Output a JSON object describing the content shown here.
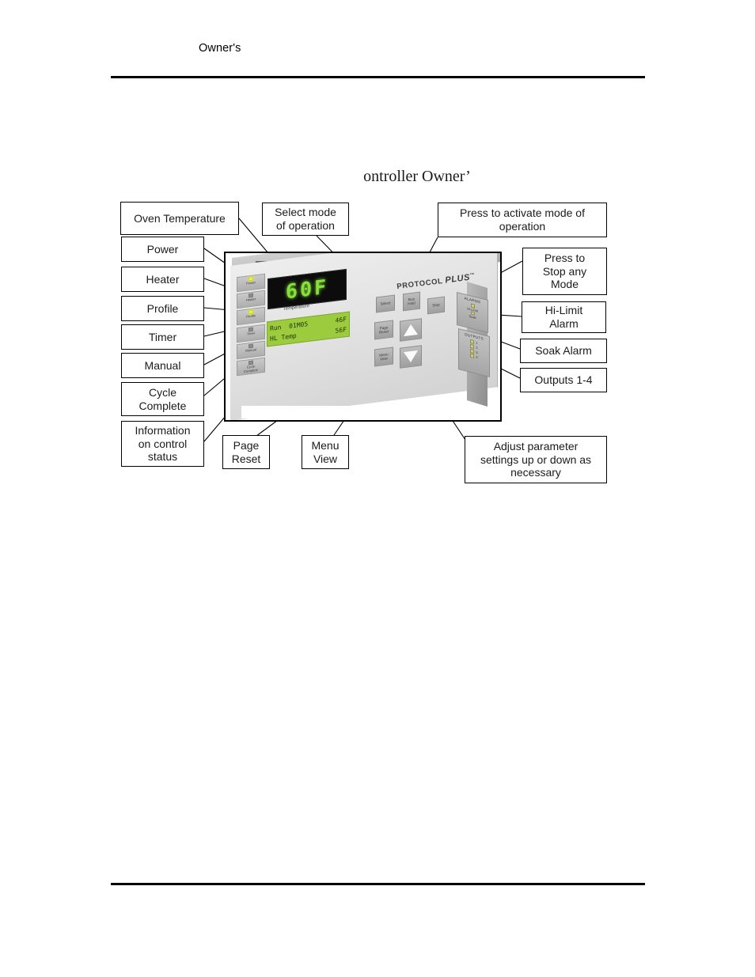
{
  "page": {
    "header_text": "Owner's",
    "title": "ontroller Owner’"
  },
  "callouts": {
    "oven_temperature": "Oven Temperature",
    "power": "Power",
    "heater": "Heater",
    "profile": "Profile",
    "timer": "Timer",
    "manual": "Manual",
    "cycle_complete": "Cycle\nComplete",
    "information_on_control_status": "Information\non control\nstatus",
    "select_mode": "Select mode\nof operation",
    "press_to_activate": "Press to activate mode of\noperation",
    "press_to_stop": "Press to\nStop any\nMode",
    "hi_limit_alarm": "Hi-Limit\nAlarm",
    "soak_alarm": "Soak Alarm",
    "outputs_1_4": "Outputs  1-4",
    "page_reset": "Page\nReset",
    "menu_view": "Menu\nView",
    "adjust_parameter": "Adjust parameter\nsettings up or down as\nnecessary"
  },
  "device": {
    "brand": "PROTOCOL",
    "brand_plus": "PLUS",
    "brand_tm": "™",
    "segment_display": "60F",
    "segment_caption": "Temperature",
    "lcd": {
      "line1_left": "Run  01M05",
      "line1_right": "46F",
      "line2_left": "HL Temp",
      "line2_right": "56F"
    },
    "led_buttons": [
      {
        "label": "Power",
        "lit": true
      },
      {
        "label": "Heater",
        "lit": false
      },
      {
        "label": "Profile",
        "lit": true
      },
      {
        "label": "Timer",
        "lit": false
      },
      {
        "label": "Manual",
        "lit": false
      },
      {
        "label": "Cycle\nComplete",
        "lit": false
      }
    ],
    "buttons": {
      "select": "Select",
      "run_hold": "Run\nHold",
      "stop": "Stop",
      "page_reset": "Page\nReset",
      "menu_view": "Menu\nView"
    },
    "alarms": {
      "title": "ALARMS",
      "hi_limit": "Hi-Limit",
      "soak": "Soak"
    },
    "outputs": {
      "title": "OUTPUTS",
      "items": [
        "1",
        "2",
        "3",
        "4"
      ]
    }
  },
  "colors": {
    "segment_green": "#86e03a",
    "lcd_green": "#9ccc3d",
    "led_on": "#e6f24a",
    "rule": "#000000"
  }
}
